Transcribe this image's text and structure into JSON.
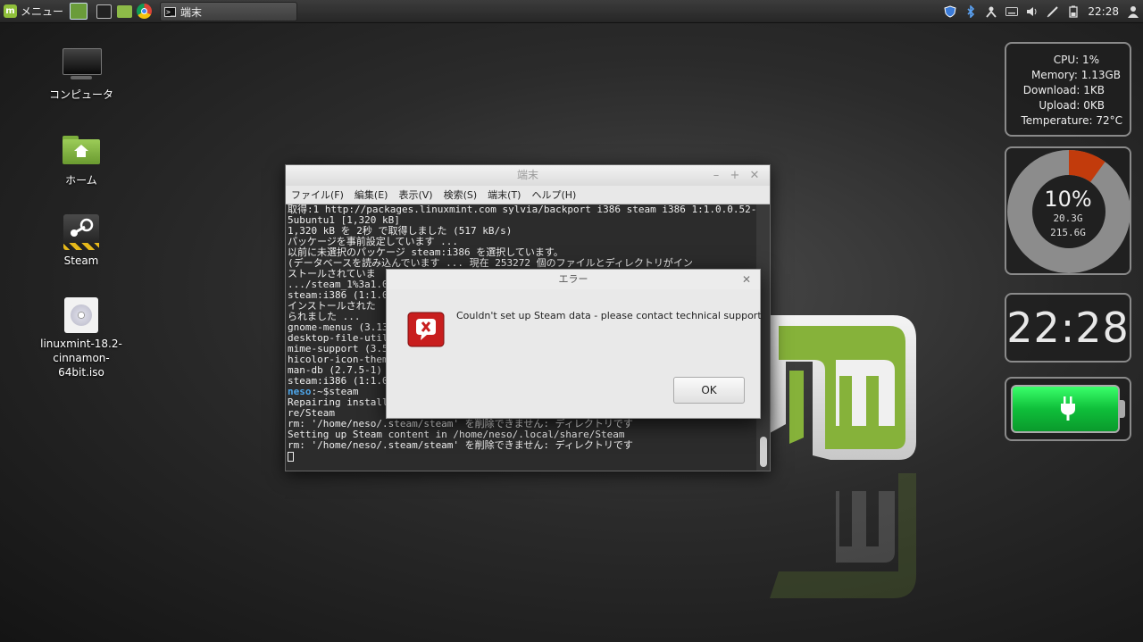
{
  "panel": {
    "menu_label": "メニュー",
    "window_button_label": "端末",
    "clock": "22:28",
    "tray_icons": [
      "shield-icon",
      "bluetooth-icon",
      "network-icon",
      "keyboard-icon",
      "volume-icon",
      "pen-icon",
      "battery-icon",
      "user-icon"
    ]
  },
  "desktop_icons": [
    {
      "label": "コンピュータ"
    },
    {
      "label": "ホーム"
    },
    {
      "label": "Steam"
    },
    {
      "label": "linuxmint-18.2-cinnamon-64bit.iso"
    }
  ],
  "sysmon": {
    "cpu": "CPU: 1%",
    "memory": "Memory: 1.13GB",
    "download": "Download: 1KB",
    "upload": "Upload: 0KB",
    "temperature": "Temperature: 72°C"
  },
  "diskmon": {
    "percent": "10%",
    "used": "20.3G",
    "total": "215.6G",
    "fraction": 0.1
  },
  "clock_desklet": {
    "time": "22:28"
  },
  "terminal": {
    "title": "端末",
    "menu": [
      "ファイル(F)",
      "編集(E)",
      "表示(V)",
      "検索(S)",
      "端末(T)",
      "ヘルプ(H)"
    ],
    "lines": [
      "取得:1 http://packages.linuxmint.com sylvia/backport i386 steam i386 1:1.0.0.52-",
      "5ubuntu1 [1,320 kB]",
      "1,320 kB を 2秒 で取得しました (517 kB/s)",
      "パッケージを事前設定しています ...",
      "以前に未選択のパッケージ steam:i386 を選択しています。",
      "(データベースを読み込んでいます ... 現在 253272 個のファイルとディレクトリがイン",
      "ストールされていま",
      ".../steam_1%3a1.0",
      "steam:i386 (1:1.0",
      "インストールされた",
      "られました ...",
      "gnome-menus (3.13",
      "desktop-file-util",
      "mime-support (3.5",
      "hicolor-icon-them",
      "man-db (2.7.5-1)",
      "steam:i386 (1:1.0"
    ],
    "prompt_user": "neso",
    "prompt_rest": ":~$steam",
    "after_lines": [
      "Repairing install",
      "re/Steam",
      "rm: '/home/neso/.steam/steam' を削除できません: ディレクトリです",
      "Setting up Steam content in /home/neso/.local/share/Steam",
      "rm: '/home/neso/.steam/steam' を削除できません: ディレクトリです"
    ]
  },
  "dialog": {
    "title": "エラー",
    "message": "Couldn't set up Steam data - please contact technical support",
    "ok_label": "OK"
  }
}
